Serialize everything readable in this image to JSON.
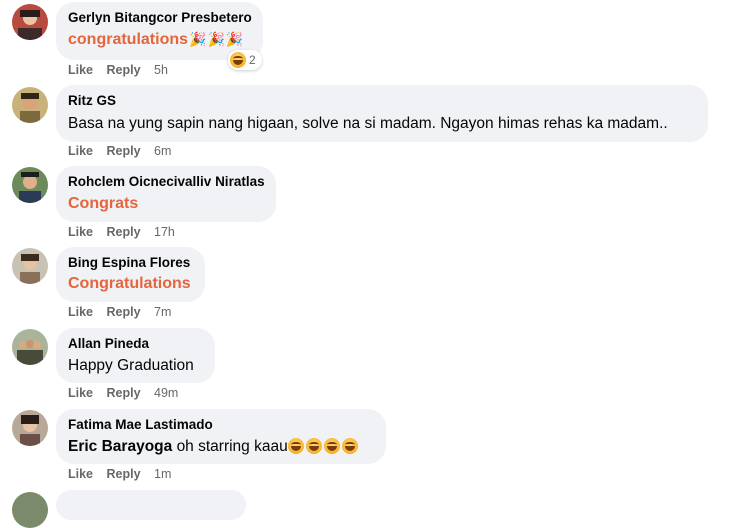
{
  "action_labels": {
    "like": "Like",
    "reply": "Reply"
  },
  "comments": [
    {
      "author": "Gerlyn Bitangcor Presbetero",
      "text": "congratulations",
      "emojis": [
        "🎉",
        "🎉",
        "🎉"
      ],
      "reaction": {
        "icon": "laugh-emoji-icon",
        "count": "2"
      },
      "time": "5h"
    },
    {
      "author": "Ritz GS",
      "text": "Basa na yung sapin nang higaan, solve na si madam. Ngayon himas rehas ka madam..",
      "time": "6m"
    },
    {
      "author": "Rohclem Oicnecivalliv Niratlas",
      "text": "Congrats",
      "time": "17h"
    },
    {
      "author": "Bing Espina Flores",
      "text": "Congratulations",
      "time": "7m"
    },
    {
      "author": "Allan Pineda",
      "text": "Happy Graduation",
      "time": "49m"
    },
    {
      "author": "Fatima Mae Lastimado",
      "mention": "Eric Barayoga",
      "text": "oh starring kaau",
      "trailing_emoji": "laugh-emoji-icon",
      "trailing_emoji_count": 4,
      "time": "1m"
    }
  ],
  "colors": {
    "bubble": "#f0f2f5",
    "celebrate_text": "#e5653c",
    "meta_text": "#65676b"
  }
}
